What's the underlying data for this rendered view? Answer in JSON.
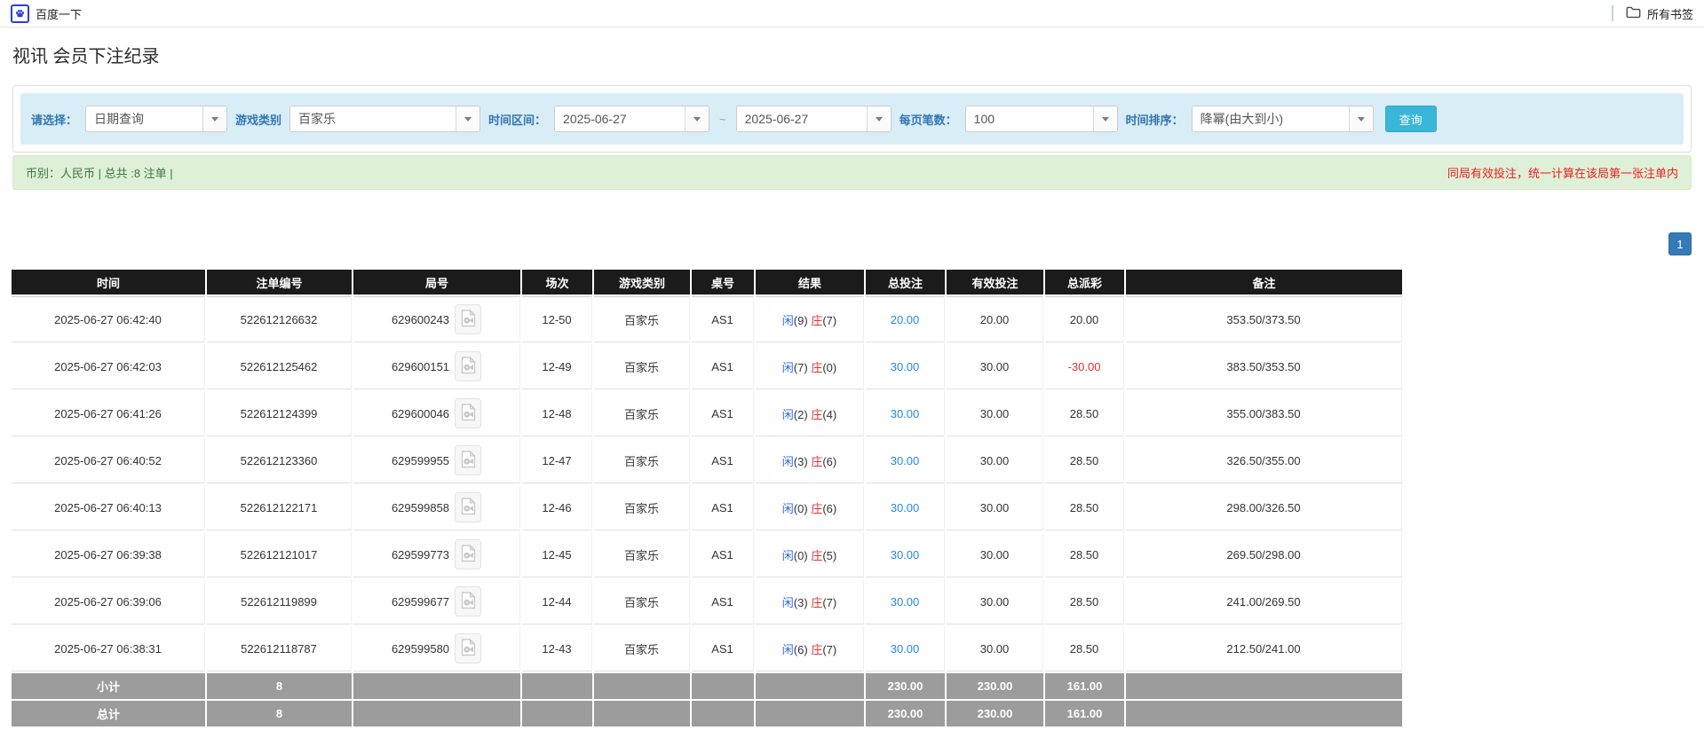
{
  "colors": {
    "accent_search_button": "#3ab6d9",
    "pagination_blue": "#337ab7",
    "link_blue": "#2489e5",
    "player_blue": "#2c6be0",
    "banker_red": "#e03333",
    "negative_red": "#e03333",
    "notice_red": "#ef1d1d",
    "summary_bg_green": "#dff0d8",
    "table_header_bg": "#1b1b1b",
    "table_footer_bg": "#9c9c9c"
  },
  "icons": {
    "bookmark_favicon": "baidu-paw-icon",
    "all_bookmarks": "folder-icon",
    "combo_arrow": "chevron-down-icon",
    "round_replay": "video-replay-icon"
  },
  "bookmarks_bar": {
    "bookmark_label": "百度一下",
    "all_bookmarks_label": "所有书签"
  },
  "page": {
    "title": "视讯 会员下注纪录"
  },
  "filters": {
    "select_label": "请选择：",
    "select_value": "日期查询",
    "game_type_label": "游戏类别",
    "game_type_value": "百家乐",
    "date_range_label": "时间区间：",
    "date_from": "2025-06-27",
    "date_separator": "~",
    "date_to": "2025-06-27",
    "page_size_label": "每页笔数：",
    "page_size_value": "100",
    "sort_label": "时间排序：",
    "sort_value": "降幂(由大到小)",
    "search_button": "查询"
  },
  "summary": {
    "left_text": "币别：人民币 | 总共 :8 注单 |",
    "right_notice": "同局有效投注，统一计算在该局第一张注单内"
  },
  "pagination": {
    "pages": [
      "1"
    ]
  },
  "table": {
    "headers": [
      "时间",
      "注单编号",
      "局号",
      "场次",
      "游戏类别",
      "桌号",
      "结果",
      "总投注",
      "有效投注",
      "总派彩",
      "备注"
    ],
    "rows": [
      {
        "time": "2025-06-27 06:42:40",
        "bet_id": "522612126632",
        "round_id": "629600243",
        "session": "12-50",
        "game_type": "百家乐",
        "table_no": "AS1",
        "result": {
          "player_label": "闲",
          "player_score": "9",
          "banker_label": "庄",
          "banker_score": "7"
        },
        "total_bet": "20.00",
        "valid_bet": "20.00",
        "payout": "20.00",
        "note": "353.50/373.50"
      },
      {
        "time": "2025-06-27 06:42:03",
        "bet_id": "522612125462",
        "round_id": "629600151",
        "session": "12-49",
        "game_type": "百家乐",
        "table_no": "AS1",
        "result": {
          "player_label": "闲",
          "player_score": "7",
          "banker_label": "庄",
          "banker_score": "0"
        },
        "total_bet": "30.00",
        "valid_bet": "30.00",
        "payout": "-30.00",
        "note": "383.50/353.50"
      },
      {
        "time": "2025-06-27 06:41:26",
        "bet_id": "522612124399",
        "round_id": "629600046",
        "session": "12-48",
        "game_type": "百家乐",
        "table_no": "AS1",
        "result": {
          "player_label": "闲",
          "player_score": "2",
          "banker_label": "庄",
          "banker_score": "4"
        },
        "total_bet": "30.00",
        "valid_bet": "30.00",
        "payout": "28.50",
        "note": "355.00/383.50"
      },
      {
        "time": "2025-06-27 06:40:52",
        "bet_id": "522612123360",
        "round_id": "629599955",
        "session": "12-47",
        "game_type": "百家乐",
        "table_no": "AS1",
        "result": {
          "player_label": "闲",
          "player_score": "3",
          "banker_label": "庄",
          "banker_score": "6"
        },
        "total_bet": "30.00",
        "valid_bet": "30.00",
        "payout": "28.50",
        "note": "326.50/355.00"
      },
      {
        "time": "2025-06-27 06:40:13",
        "bet_id": "522612122171",
        "round_id": "629599858",
        "session": "12-46",
        "game_type": "百家乐",
        "table_no": "AS1",
        "result": {
          "player_label": "闲",
          "player_score": "0",
          "banker_label": "庄",
          "banker_score": "6"
        },
        "total_bet": "30.00",
        "valid_bet": "30.00",
        "payout": "28.50",
        "note": "298.00/326.50"
      },
      {
        "time": "2025-06-27 06:39:38",
        "bet_id": "522612121017",
        "round_id": "629599773",
        "session": "12-45",
        "game_type": "百家乐",
        "table_no": "AS1",
        "result": {
          "player_label": "闲",
          "player_score": "0",
          "banker_label": "庄",
          "banker_score": "5"
        },
        "total_bet": "30.00",
        "valid_bet": "30.00",
        "payout": "28.50",
        "note": "269.50/298.00"
      },
      {
        "time": "2025-06-27 06:39:06",
        "bet_id": "522612119899",
        "round_id": "629599677",
        "session": "12-44",
        "game_type": "百家乐",
        "table_no": "AS1",
        "result": {
          "player_label": "闲",
          "player_score": "3",
          "banker_label": "庄",
          "banker_score": "7"
        },
        "total_bet": "30.00",
        "valid_bet": "30.00",
        "payout": "28.50",
        "note": "241.00/269.50"
      },
      {
        "time": "2025-06-27 06:38:31",
        "bet_id": "522612118787",
        "round_id": "629599580",
        "session": "12-43",
        "game_type": "百家乐",
        "table_no": "AS1",
        "result": {
          "player_label": "闲",
          "player_score": "6",
          "banker_label": "庄",
          "banker_score": "7"
        },
        "total_bet": "30.00",
        "valid_bet": "30.00",
        "payout": "28.50",
        "note": "212.50/241.00"
      }
    ],
    "subtotal": {
      "label": "小计",
      "count": "8",
      "total_bet": "230.00",
      "valid_bet": "230.00",
      "payout": "161.00"
    },
    "grand_total": {
      "label": "总计",
      "count": "8",
      "total_bet": "230.00",
      "valid_bet": "230.00",
      "payout": "161.00"
    }
  }
}
